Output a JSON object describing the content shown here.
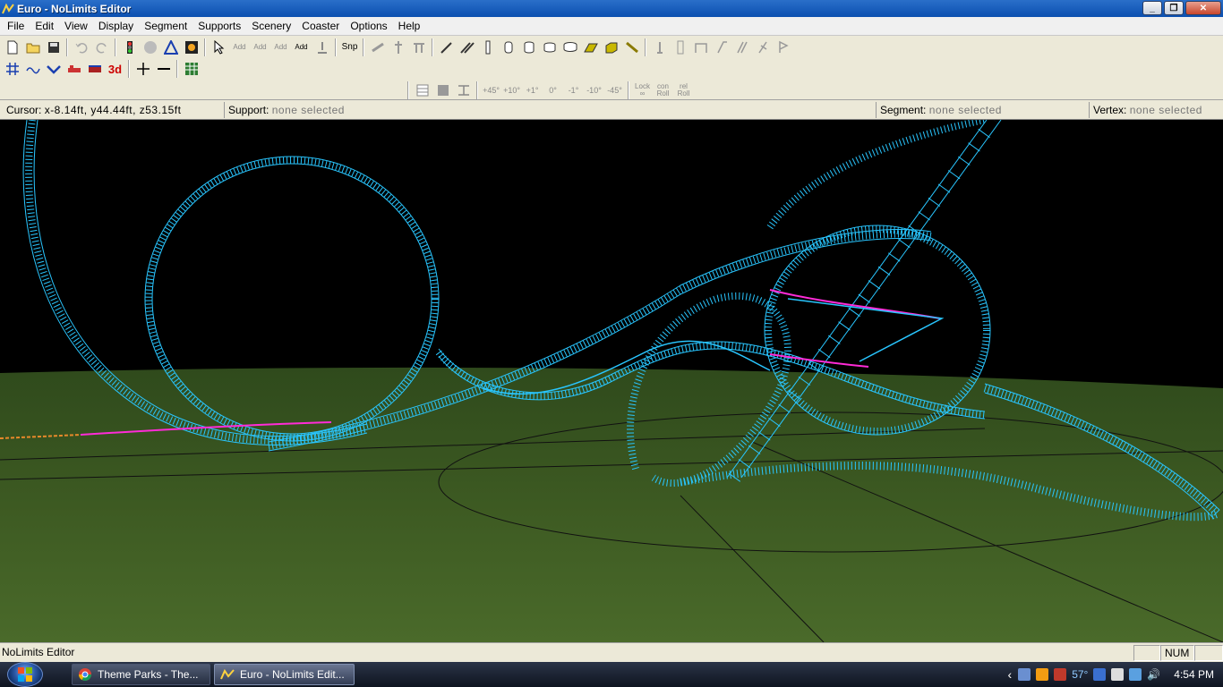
{
  "window": {
    "title": "Euro - NoLimits Editor",
    "minimize_label": "_",
    "maximize_label": "❐",
    "close_label": "✕"
  },
  "menu": {
    "items": [
      {
        "label": "File"
      },
      {
        "label": "Edit"
      },
      {
        "label": "View"
      },
      {
        "label": "Display"
      },
      {
        "label": "Segment"
      },
      {
        "label": "Supports"
      },
      {
        "label": "Scenery"
      },
      {
        "label": "Coaster"
      },
      {
        "label": "Options"
      },
      {
        "label": "Help"
      }
    ]
  },
  "toolbar": {
    "snap_label": "Snp",
    "add_labels": [
      "Add",
      "Add",
      "Add",
      "Add"
    ],
    "threed_label": "3d",
    "roll_labels": [
      "+45°",
      "+10°",
      "+1°",
      "0°",
      "-1°",
      "-10°",
      "-45°"
    ],
    "lock_label": "Lock",
    "con_label": "con",
    "rel_label": "rel",
    "roll_label": "Roll"
  },
  "infobar": {
    "cursor_label": "Cursor:",
    "cursor_value": "x-8.14ft, y44.44ft, z53.15ft",
    "support_label": "Support:",
    "support_value": "none selected",
    "segment_label": "Segment:",
    "segment_value": "none selected",
    "vertex_label": "Vertex:",
    "vertex_value": "none selected"
  },
  "status": {
    "text": "NoLimits Editor",
    "num": "NUM"
  },
  "taskbar": {
    "tasks": [
      {
        "label": "Theme Parks - The..."
      },
      {
        "label": "Euro - NoLimits Edit..."
      }
    ],
    "temp": "57°",
    "clock": "4:54 PM"
  },
  "colors": {
    "track": "#29c6ff",
    "selected_track": "#ff2bd8",
    "grass": "#3d5a22",
    "sky": "#000000",
    "title_bar": "#0b4fb0"
  }
}
